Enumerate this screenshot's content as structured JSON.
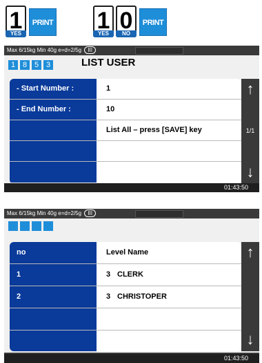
{
  "keys": {
    "yes_key": {
      "digit": "1",
      "label": "YES"
    },
    "print_key_1": {
      "label": "PRINT"
    },
    "yes_key_2": {
      "digit": "1",
      "label": "YES"
    },
    "no_key": {
      "digit": "0",
      "label": "NO"
    },
    "print_key_2": {
      "label": "PRINT"
    }
  },
  "screen1": {
    "status": "Max 6/15kg Min 40g e=d=2/5g",
    "range": "III",
    "code_digits": [
      "1",
      "8",
      "5",
      "3"
    ],
    "title": "LIST USER",
    "rows": [
      {
        "label": "- Start Number :",
        "value": "1"
      },
      {
        "label": "- End Number  :",
        "value": "10"
      },
      {
        "label": "",
        "value": "List All – press [SAVE] key"
      },
      {
        "label": "",
        "value": ""
      },
      {
        "label": "",
        "value": ""
      }
    ],
    "page": "1/1",
    "time": "01:43:50"
  },
  "screen2": {
    "status": "Max 6/15kg Min 40g e=d=2/5g",
    "range": "III",
    "code_digits": [
      "",
      "",
      "",
      ""
    ],
    "header": {
      "col1": "no",
      "col2": "Level Name"
    },
    "rows": [
      {
        "no": "1",
        "level": "3",
        "name": "CLERK"
      },
      {
        "no": "2",
        "level": "3",
        "name": "CHRISTOPER"
      },
      {
        "no": "",
        "level": "",
        "name": ""
      },
      {
        "no": "",
        "level": "",
        "name": ""
      }
    ],
    "time": "01:43:50"
  },
  "icons": {
    "up": "arrow-up-icon",
    "down": "arrow-down-icon"
  },
  "colors": {
    "accent_blue": "#1f8ed9",
    "label_blue": "#0a3a9a",
    "screen_dark": "#3a3a3a"
  }
}
